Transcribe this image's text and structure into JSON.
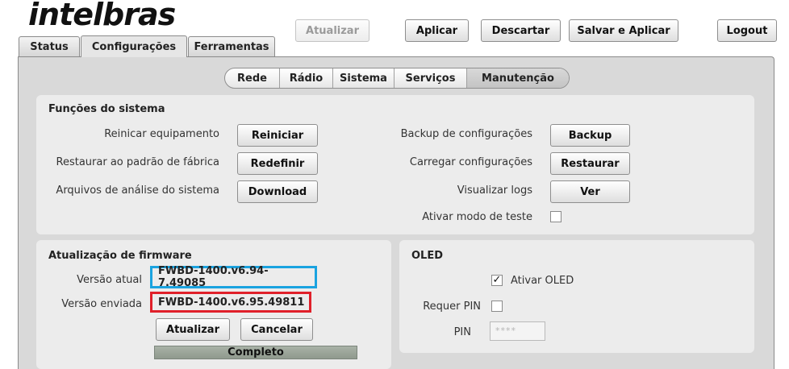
{
  "brand": {
    "logo_text": "intelbras"
  },
  "header": {
    "atualizar": "Atualizar",
    "aplicar": "Aplicar",
    "descartar": "Descartar",
    "salvar_aplicar": "Salvar e Aplicar",
    "logout": "Logout"
  },
  "tabs": {
    "status": "Status",
    "configuracoes": "Configurações",
    "ferramentas": "Ferramentas"
  },
  "subnav": {
    "rede": "Rede",
    "radio": "Rádio",
    "sistema": "Sistema",
    "servicos": "Serviços",
    "manutencao": "Manutenção"
  },
  "funcoes": {
    "title": "Funções do sistema",
    "reiniciar_label": "Reinicar equipamento",
    "reiniciar_btn": "Reiniciar",
    "restaurar_padrao_label": "Restaurar ao padrão de fábrica",
    "redefinir_btn": "Redefinir",
    "analise_label": "Arquivos de análise do sistema",
    "download_btn": "Download",
    "backup_label": "Backup de configurações",
    "backup_btn": "Backup",
    "carregar_label": "Carregar configurações",
    "restaurar_btn": "Restaurar",
    "logs_label": "Visualizar logs",
    "ver_btn": "Ver",
    "teste_label": "Ativar modo de teste",
    "teste_checked": false
  },
  "firmware": {
    "title": "Atualização de firmware",
    "atual_label": "Versão atual",
    "atual_value": "FWBD-1400.v6.94-7.49085",
    "enviada_label": "Versão enviada",
    "enviada_value": "FWBD-1400.v6.95.49811",
    "atualizar_btn": "Atualizar",
    "cancelar_btn": "Cancelar",
    "progress_text": "Completo",
    "progress_percent": 100,
    "highlight_colors": {
      "atual": "#1aa3e0",
      "enviada": "#e0202a"
    }
  },
  "oled": {
    "title": "OLED",
    "ativar_label": "Ativar OLED",
    "ativar_checked": true,
    "requer_pin_label": "Requer PIN",
    "requer_pin_checked": false,
    "pin_label": "PIN",
    "pin_placeholder": "****"
  }
}
